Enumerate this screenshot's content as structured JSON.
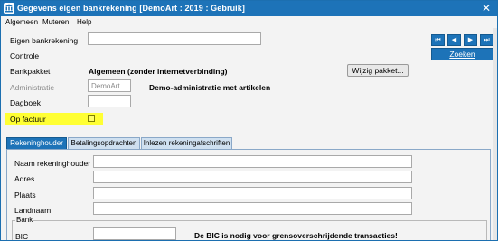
{
  "window": {
    "title": "Gegevens eigen bankrekening  [DemoArt : 2019 : Gebruik]",
    "close_label": "✕",
    "accent_color": "#1d73b8"
  },
  "menu": [
    "Algemeen",
    "Muteren",
    "Help"
  ],
  "form": {
    "eigen_bankrekening": {
      "label": "Eigen bankrekening",
      "value": ""
    },
    "controle": {
      "label": "Controle"
    },
    "bankpakket": {
      "label": "Bankpakket",
      "value": "Algemeen (zonder internetverbinding)",
      "button": "Wijzig pakket..."
    },
    "administratie": {
      "label": "Administratie",
      "value": "DemoArt",
      "description": "Demo-administratie met artikelen"
    },
    "dagboek": {
      "label": "Dagboek",
      "value": ""
    },
    "op_factuur": {
      "label": "Op factuur",
      "checked": false,
      "highlight_color": "#ffff33"
    }
  },
  "nav_buttons": [
    "⏮",
    "◀",
    "▶",
    "⏭"
  ],
  "zoeken_label": "Zoeken",
  "tabs": [
    {
      "label": "Rekeninghouder",
      "active": true
    },
    {
      "label": "Betalingsopdrachten",
      "active": false
    },
    {
      "label": "Inlezen rekeningafschriften",
      "active": false
    }
  ],
  "rekeninghouder": {
    "naam": {
      "label": "Naam rekeninghouder",
      "value": ""
    },
    "adres": {
      "label": "Adres",
      "value": ""
    },
    "plaats": {
      "label": "Plaats",
      "value": ""
    },
    "landnaam": {
      "label": "Landnaam",
      "value": ""
    }
  },
  "bank": {
    "group_label": "Bank",
    "bic": {
      "label": "BIC",
      "value": ""
    },
    "bic_note": "De BIC is nodig voor grensoverschrijdende transacties!"
  }
}
